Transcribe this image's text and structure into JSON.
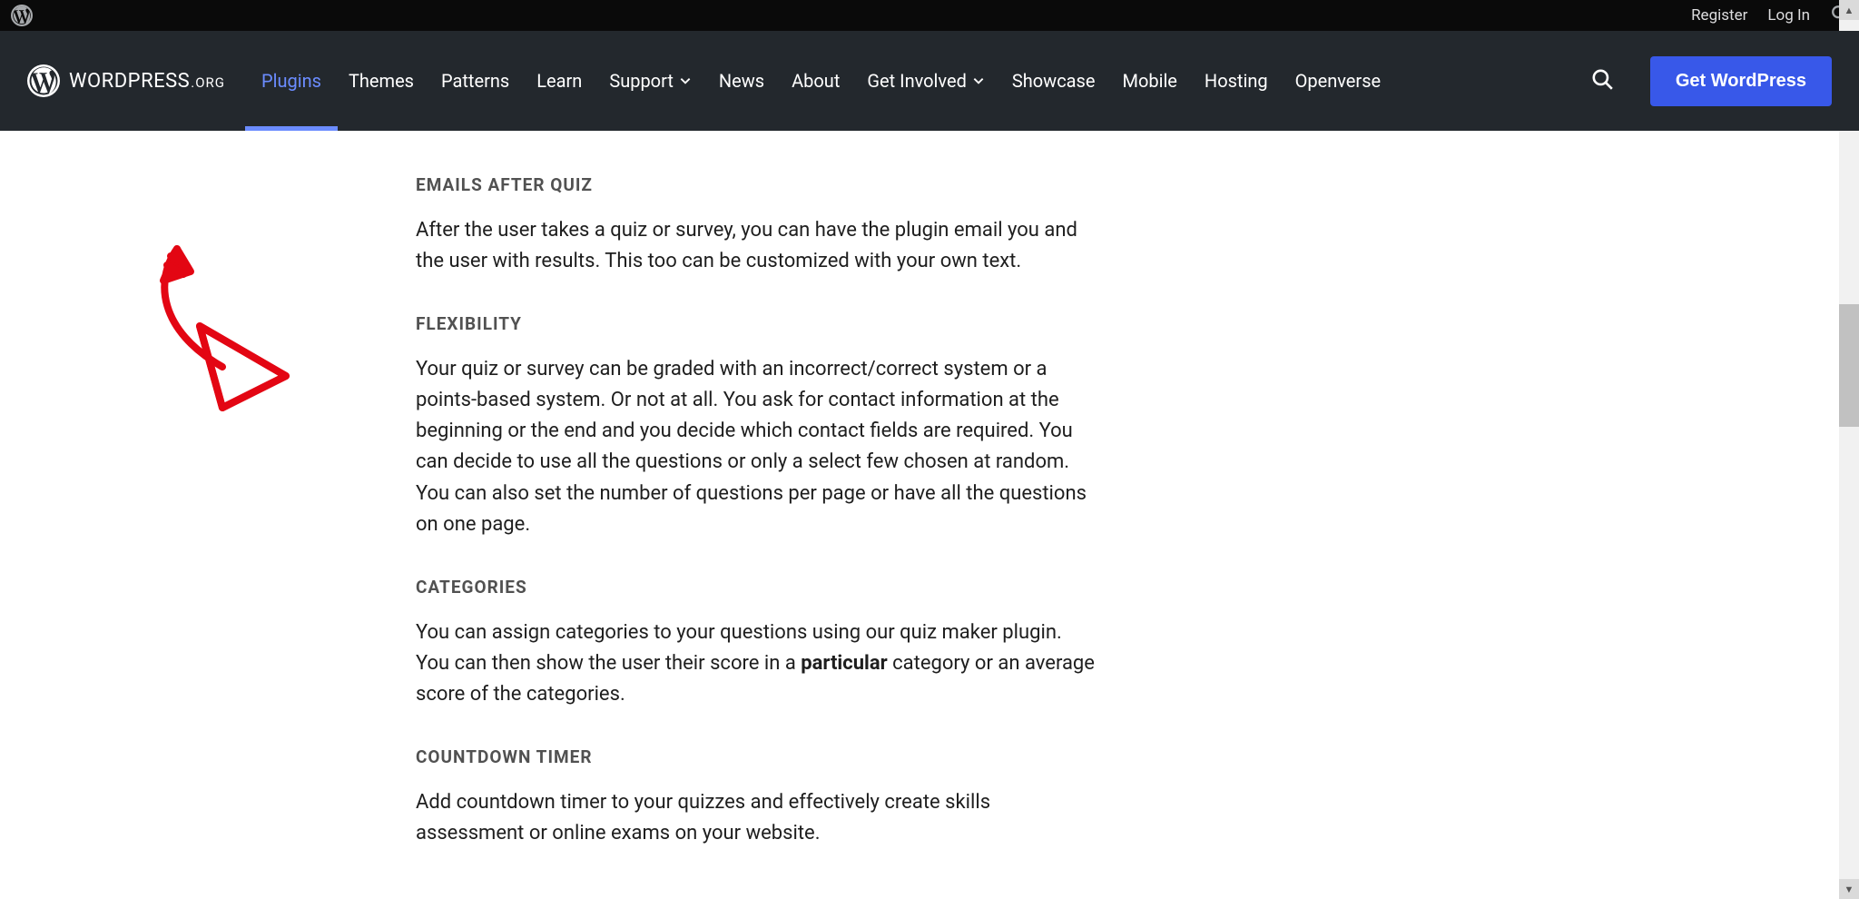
{
  "adminBar": {
    "register": "Register",
    "logIn": "Log In"
  },
  "brand": {
    "name": "WordPress",
    "suffix": ".ORG"
  },
  "nav": {
    "items": [
      {
        "label": "Plugins",
        "active": true,
        "hasDropdown": false
      },
      {
        "label": "Themes",
        "active": false,
        "hasDropdown": false
      },
      {
        "label": "Patterns",
        "active": false,
        "hasDropdown": false
      },
      {
        "label": "Learn",
        "active": false,
        "hasDropdown": false
      },
      {
        "label": "Support",
        "active": false,
        "hasDropdown": true
      },
      {
        "label": "News",
        "active": false,
        "hasDropdown": false
      },
      {
        "label": "About",
        "active": false,
        "hasDropdown": false
      },
      {
        "label": "Get Involved",
        "active": false,
        "hasDropdown": true
      },
      {
        "label": "Showcase",
        "active": false,
        "hasDropdown": false
      },
      {
        "label": "Mobile",
        "active": false,
        "hasDropdown": false
      },
      {
        "label": "Hosting",
        "active": false,
        "hasDropdown": false
      },
      {
        "label": "Openverse",
        "active": false,
        "hasDropdown": false
      }
    ]
  },
  "cta": {
    "getWordPress": "Get WordPress"
  },
  "sections": [
    {
      "title": "EMAILS AFTER QUIZ",
      "body_a": "After the user takes a quiz or survey, you can have the plugin email you and the user with results. This too can be customized with your own text.",
      "strong": "",
      "body_b": ""
    },
    {
      "title": "FLEXIBILITY",
      "body_a": "Your quiz or survey can be graded with an incorrect/correct system or a points-based system. Or not at all. You ask for contact information at the beginning or the end and you decide which contact fields are required. You can decide to use all the questions or only a select few chosen at random. You can also set the number of questions per page or have all the questions on one page.",
      "strong": "",
      "body_b": ""
    },
    {
      "title": "CATEGORIES",
      "body_a": "You can assign categories to your questions using our quiz maker plugin. You can then show the user their score in a ",
      "strong": "particular",
      "body_b": " category or an average score of the categories."
    },
    {
      "title": "COUNTDOWN TIMER",
      "body_a": "Add countdown timer to your quizzes and effectively create skills assessment or online exams on your website.",
      "strong": "",
      "body_b": ""
    }
  ],
  "annotation": {
    "name": "hand-drawn-arrow",
    "color": "#e30613"
  },
  "scrollbar": {
    "thumbTop": 335,
    "thumbHeight": 135
  }
}
